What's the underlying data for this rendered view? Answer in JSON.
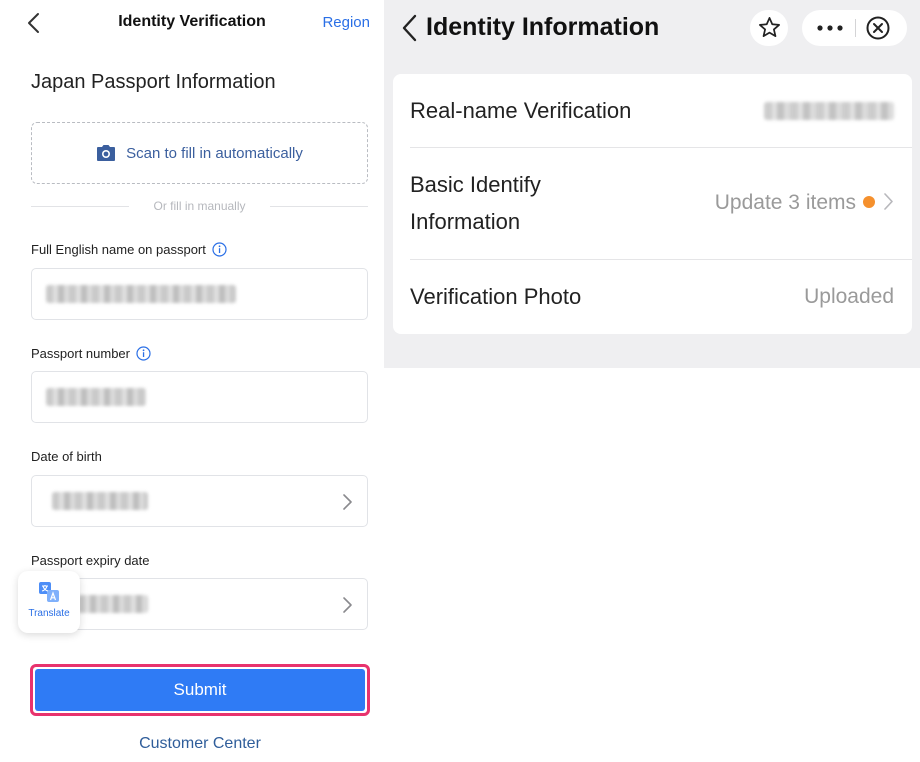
{
  "left": {
    "nav": {
      "title": "Identity Verification",
      "region": "Region"
    },
    "section_title": "Japan Passport Information",
    "scan": {
      "label": "Scan to fill in automatically"
    },
    "divider_text": "Or fill in manually",
    "fields": {
      "full_name": {
        "label": "Full English name on passport",
        "value": "[redacted]"
      },
      "passport_number": {
        "label": "Passport number",
        "value": "[redacted]"
      },
      "date_of_birth": {
        "label": "Date of birth",
        "value": "[redacted]"
      },
      "expiry": {
        "label": "Passport expiry date",
        "value": "[redacted]"
      }
    },
    "translate_label": "Translate",
    "submit_label": "Submit",
    "customer_center": "Customer Center",
    "colors": {
      "accent": "#2f7bf5",
      "link": "#2a6fe6",
      "highlight_border": "#e8336e"
    }
  },
  "right": {
    "nav": {
      "title": "Identity Information"
    },
    "rows": [
      {
        "label": "Real-name Verification",
        "value": "[redacted]"
      },
      {
        "label_line1": "Basic Identify",
        "label_line2": "Information",
        "value": "Update 3 items"
      },
      {
        "label": "Verification Photo",
        "value": "Uploaded"
      }
    ],
    "colors": {
      "status_dot": "#f5902d",
      "background": "#efeff1"
    }
  },
  "icons": [
    "back-chevron-icon",
    "info-icon",
    "camera-icon",
    "chevron-right-icon",
    "translate-icon",
    "star-icon",
    "more-icon",
    "close-circle-icon"
  ]
}
